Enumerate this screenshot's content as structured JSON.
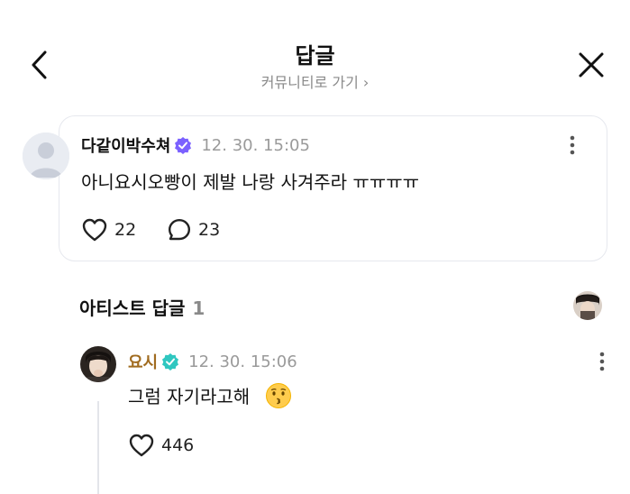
{
  "header": {
    "title": "답글",
    "subtitle": "커뮤니티로 가기 ›"
  },
  "post": {
    "author": "다같이박수쳐",
    "timestamp": "12. 30. 15:05",
    "text": "아니요시오빵이 제발 나랑 사겨주라 ㅠㅠㅠㅠ",
    "likes": "22",
    "comments": "23"
  },
  "section": {
    "title": "아티스트 답글",
    "count": "1"
  },
  "reply": {
    "author": "요시",
    "timestamp": "12. 30. 15:06",
    "text": "그럼 자기라고해",
    "likes": "446"
  },
  "colors": {
    "accent_badge": "#7b61ff",
    "verified_badge": "#2fc7c0",
    "artist_name": "#a06b1f"
  },
  "icons": [
    "chevron-left-icon",
    "close-icon",
    "verified-badge-icon",
    "more-vertical-icon",
    "heart-icon",
    "comment-icon",
    "kissing-emoji-icon"
  ]
}
